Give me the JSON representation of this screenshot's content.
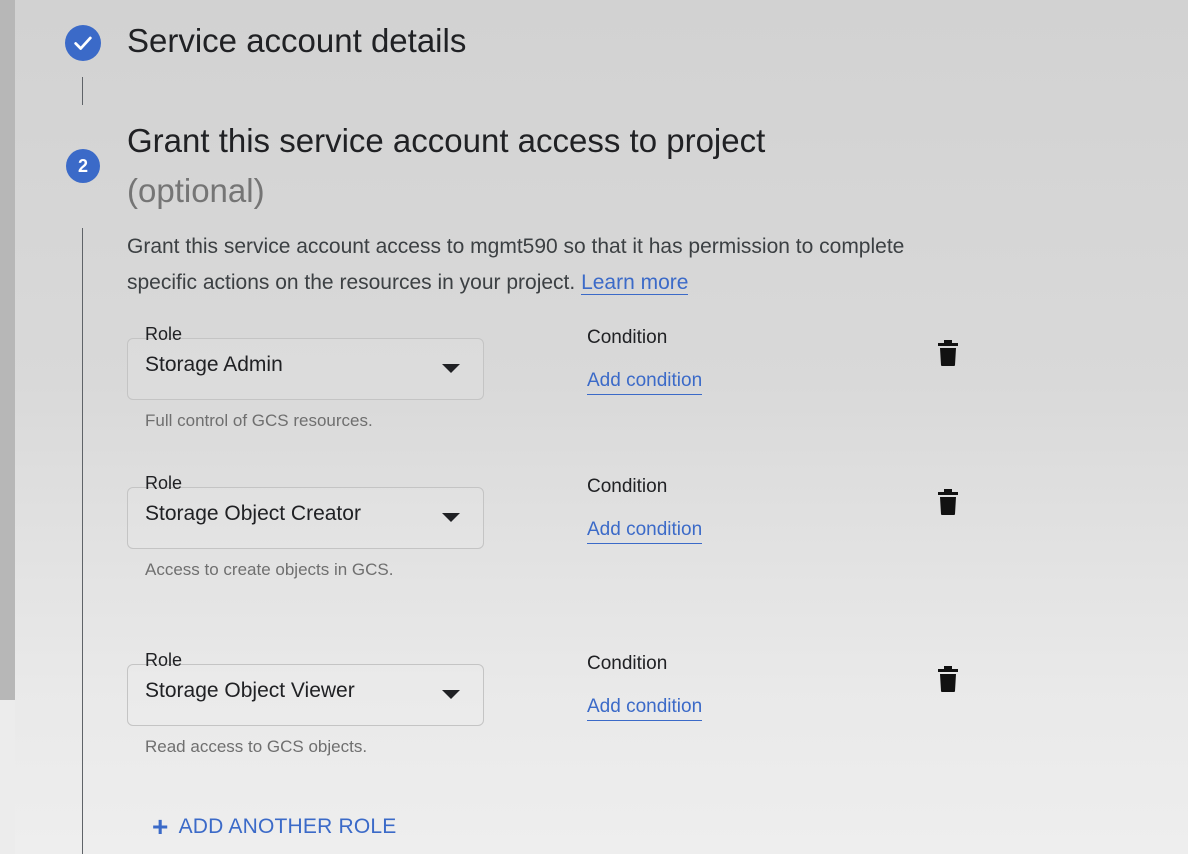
{
  "step1": {
    "title": "Service account details",
    "status": "complete",
    "icon": "check-icon"
  },
  "step2": {
    "number": "2",
    "title": "Grant this service account access to project",
    "optional": "(optional)",
    "description": "Grant this service account access to mgmt590 so that it has permission to complete specific actions on the resources in your project.",
    "learn_more": "Learn more"
  },
  "roles": [
    {
      "label": "Role",
      "value": "Storage Admin",
      "help": "Full control of GCS resources.",
      "condition_label": "Condition",
      "condition_link": "Add condition"
    },
    {
      "label": "Role",
      "value": "Storage Object Creator",
      "help": "Access to create objects in GCS.",
      "condition_label": "Condition",
      "condition_link": "Add condition"
    },
    {
      "label": "Role",
      "value": "Storage Object Viewer",
      "help": "Read access to GCS objects.",
      "condition_label": "Condition",
      "condition_link": "Add condition"
    }
  ],
  "add_role": {
    "icon": "plus-icon",
    "label": "ADD ANOTHER ROLE"
  },
  "colors": {
    "accent": "#3b6ac8",
    "text": "#202124",
    "muted": "#757575"
  }
}
